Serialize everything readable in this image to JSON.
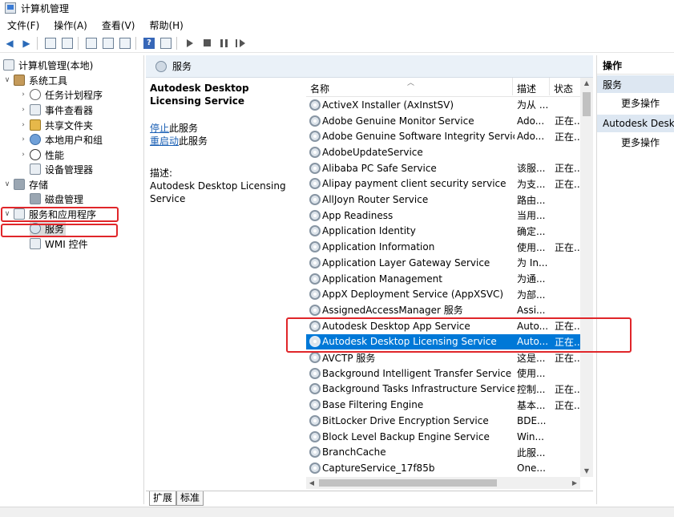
{
  "window": {
    "title": "计算机管理"
  },
  "menubar": [
    "文件(F)",
    "操作(A)",
    "查看(V)",
    "帮助(H)"
  ],
  "tree": {
    "root": "计算机管理(本地)",
    "system_tools": "系统工具",
    "task_scheduler": "任务计划程序",
    "event_viewer": "事件查看器",
    "shared_folders": "共享文件夹",
    "local_users": "本地用户和组",
    "performance": "性能",
    "device_manager": "设备管理器",
    "storage": "存储",
    "disk_management": "磁盘管理",
    "services_apps": "服务和应用程序",
    "services": "服务",
    "wmi": "WMI 控件"
  },
  "detail": {
    "header": "服务",
    "selected_title": "Autodesk Desktop Licensing Service",
    "stop_link": "停止",
    "stop_suffix": "此服务",
    "restart_link": "重启动",
    "restart_suffix": "此服务",
    "desc_label": "描述:",
    "desc_text": "Autodesk Desktop Licensing Service"
  },
  "list": {
    "columns": {
      "name": "名称",
      "desc": "描述",
      "status": "状态"
    },
    "rows": [
      {
        "name": "ActiveX Installer (AxInstSV)",
        "desc": "为从 ...",
        "status": ""
      },
      {
        "name": "Adobe Genuine Monitor Service",
        "desc": "Ado...",
        "status": "正在..."
      },
      {
        "name": "Adobe Genuine Software Integrity Service",
        "desc": "Ado...",
        "status": "正在..."
      },
      {
        "name": "AdobeUpdateService",
        "desc": "",
        "status": ""
      },
      {
        "name": "Alibaba PC Safe Service",
        "desc": "该服...",
        "status": "正在..."
      },
      {
        "name": "Alipay payment client security service",
        "desc": "为支...",
        "status": "正在..."
      },
      {
        "name": "AllJoyn Router Service",
        "desc": "路由...",
        "status": ""
      },
      {
        "name": "App Readiness",
        "desc": "当用...",
        "status": ""
      },
      {
        "name": "Application Identity",
        "desc": "确定...",
        "status": ""
      },
      {
        "name": "Application Information",
        "desc": "使用...",
        "status": "正在..."
      },
      {
        "name": "Application Layer Gateway Service",
        "desc": "为 In...",
        "status": ""
      },
      {
        "name": "Application Management",
        "desc": "为通...",
        "status": ""
      },
      {
        "name": "AppX Deployment Service (AppXSVC)",
        "desc": "为部...",
        "status": ""
      },
      {
        "name": "AssignedAccessManager 服务",
        "desc": "Assi...",
        "status": ""
      },
      {
        "name": "Autodesk Desktop App Service",
        "desc": "Auto...",
        "status": "正在..."
      },
      {
        "name": "Autodesk Desktop Licensing Service",
        "desc": "Auto...",
        "status": "正在..."
      },
      {
        "name": "AVCTP 服务",
        "desc": "这是...",
        "status": "正在..."
      },
      {
        "name": "Background Intelligent Transfer Service",
        "desc": "使用...",
        "status": ""
      },
      {
        "name": "Background Tasks Infrastructure Service",
        "desc": "控制...",
        "status": "正在..."
      },
      {
        "name": "Base Filtering Engine",
        "desc": "基本...",
        "status": "正在..."
      },
      {
        "name": "BitLocker Drive Encryption Service",
        "desc": "BDE...",
        "status": ""
      },
      {
        "name": "Block Level Backup Engine Service",
        "desc": "Win...",
        "status": ""
      },
      {
        "name": "BranchCache",
        "desc": "此服...",
        "status": ""
      },
      {
        "name": "CaptureService_17f85b",
        "desc": "One...",
        "status": ""
      }
    ]
  },
  "tabs": {
    "extended": "扩展",
    "standard": "标准"
  },
  "actions": {
    "header": "操作",
    "section1": "服务",
    "more1": "更多操作",
    "section2": "Autodesk Desktop Licensing Service",
    "more2": "更多操作"
  },
  "colors": {
    "selection": "#0078d7",
    "annotation": "#e0262a",
    "link": "#1a5fb4"
  }
}
